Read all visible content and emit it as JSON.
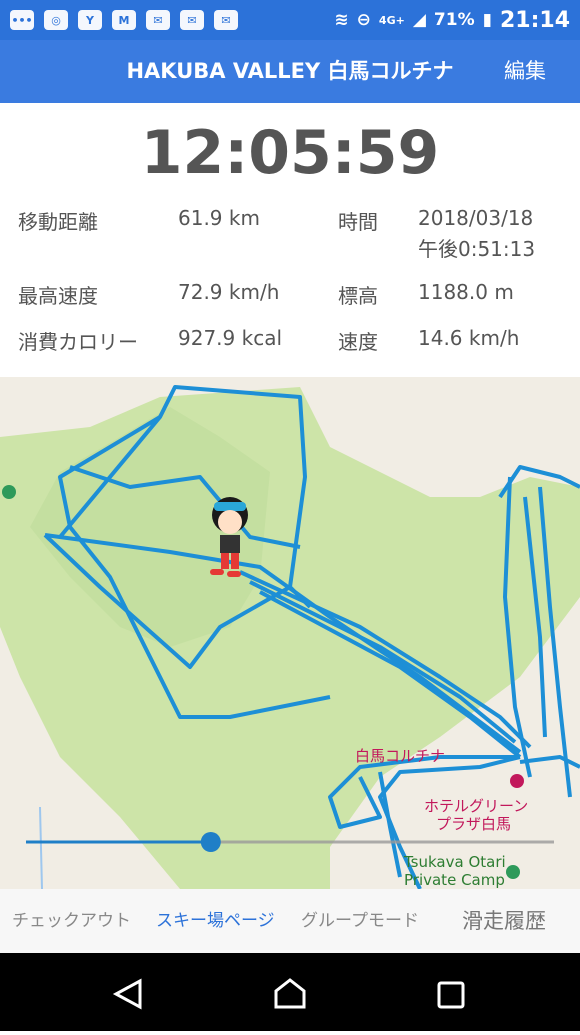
{
  "status_bar": {
    "network": "4G+",
    "battery": "71%",
    "time": "21:14",
    "accent": "#2c72d9"
  },
  "header": {
    "title": "HAKUBA VALLEY 白馬コルチナ",
    "edit_label": "編集",
    "color": "#3a7be0"
  },
  "timer": "12:05:59",
  "stats": {
    "distance": {
      "label": "移動距離",
      "value": "61.9 km"
    },
    "time": {
      "label": "時間",
      "value_line1": "2018/03/18",
      "value_line2": "午後0:51:13"
    },
    "max_speed": {
      "label": "最高速度",
      "value": "72.9 km/h"
    },
    "altitude": {
      "label": "標高",
      "value": "1188.0 m"
    },
    "calories": {
      "label": "消費カロリー",
      "value": "927.9 kcal"
    },
    "speed": {
      "label": "速度",
      "value": "14.6 km/h"
    }
  },
  "map": {
    "labels": {
      "place1": "白馬コルチナ",
      "hotel_line1": "ホテルグリーン",
      "hotel_line2": "プラザ白馬",
      "camp_line1": "Tsukava Otari",
      "camp_line2": "Private Camp"
    },
    "slider_position": 0.35,
    "track_color": "#1d8fd6",
    "park_color": "#cde4a8"
  },
  "bottom_nav": {
    "checkout": "チェックアウト",
    "ski_page": "スキー場ページ",
    "group_mode": "グループモード",
    "history": "滑走履歴"
  },
  "icons": [
    "back-icon",
    "home-icon",
    "recents-icon",
    "wifi-icon",
    "signal-icon",
    "battery-icon"
  ]
}
